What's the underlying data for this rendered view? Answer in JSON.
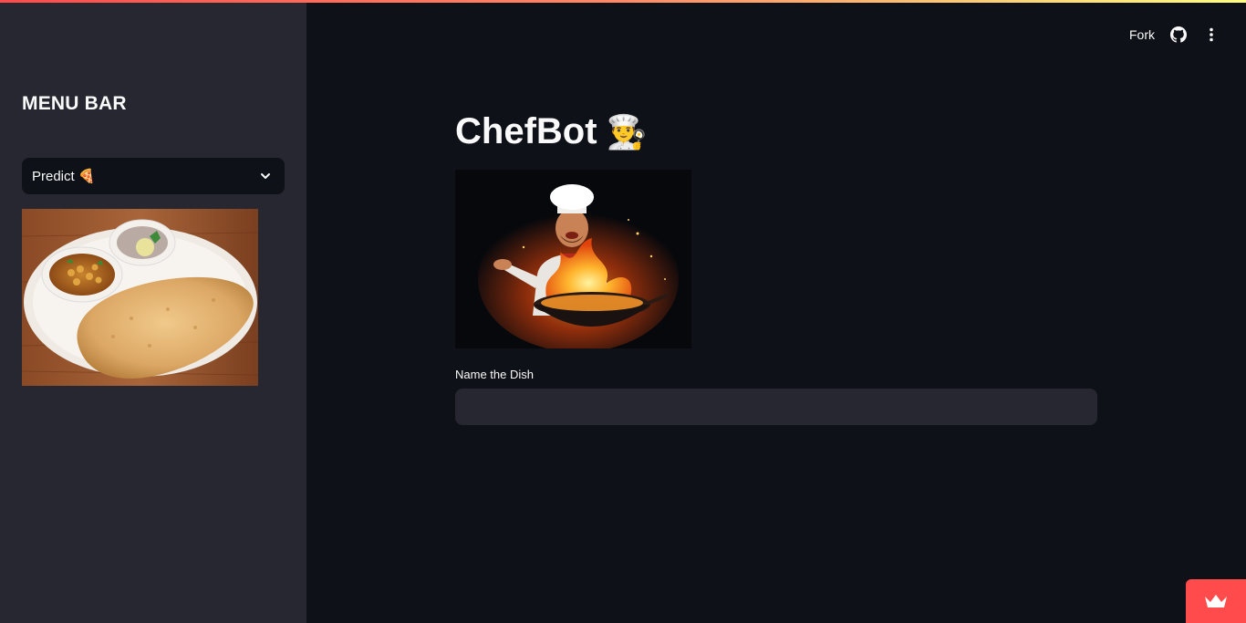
{
  "app": {
    "accent_color": "#ff4b4b",
    "sidebar_bg": "#262730",
    "main_bg": "#0e1117"
  },
  "sidebar": {
    "title": "MENU BAR",
    "select": {
      "value": "Predict 🍕"
    },
    "image_icon": "chole-bhature-photo"
  },
  "header": {
    "fork_label": "Fork",
    "github_icon": "github-icon",
    "menu_icon": "vertical-dots-icon"
  },
  "main": {
    "title": "ChefBot",
    "title_emoji": "👨‍🍳",
    "hero_image_icon": "chef-flaming-wok-photo",
    "dish_label": "Name the Dish",
    "dish_value": "",
    "dish_placeholder": ""
  },
  "footer": {
    "badge_icon": "crown-icon"
  }
}
